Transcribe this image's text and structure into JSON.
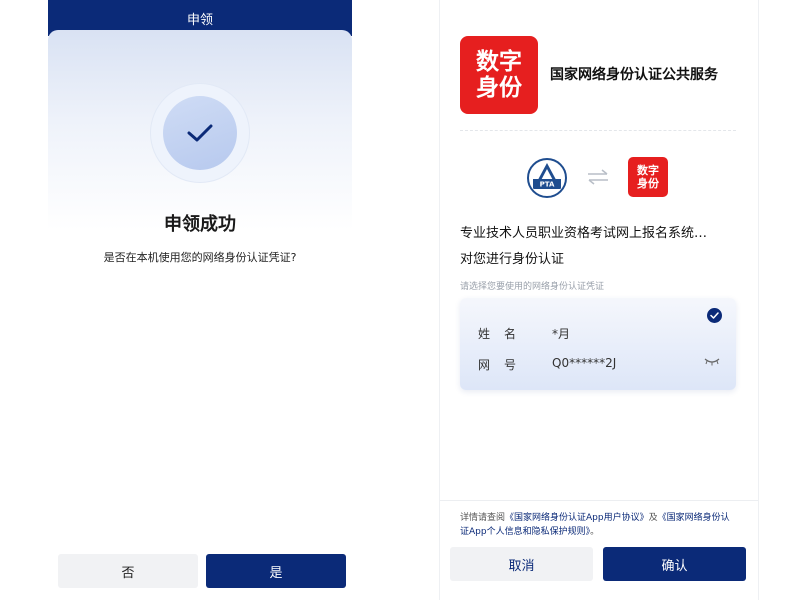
{
  "left_screen": {
    "header_title": "申领",
    "success_title": "申领成功",
    "question": "是否在本机使用您的网络身份认证凭证?",
    "no_label": "否",
    "yes_label": "是"
  },
  "right_screen": {
    "logo_line1": "数字",
    "logo_line2": "身份",
    "service_title": "国家网络身份认证公共服务",
    "partner_logo_text": "PTA",
    "small_logo_line1": "数字",
    "small_logo_line2": "身份",
    "system_line1": "专业技术人员职业资格考试网上报名系统…",
    "system_line2": "对您进行身份认证",
    "choose_hint": "请选择您要使用的网络身份认证凭证",
    "credential": {
      "name_label": "姓名",
      "name_value": "*月",
      "number_label": "网号",
      "number_value": "Q0******2J"
    },
    "agreement": {
      "prefix": "详情请查阅",
      "link1": "《国家网络身份认证App用户协议》",
      "middle": "及",
      "link2": "《国家网络身份认证App个人信息和隐私保护规则》",
      "suffix": "。"
    },
    "cancel_label": "取消",
    "confirm_label": "确认"
  },
  "colors": {
    "brand_navy": "#0b2a78",
    "brand_red": "#e61f1f"
  }
}
